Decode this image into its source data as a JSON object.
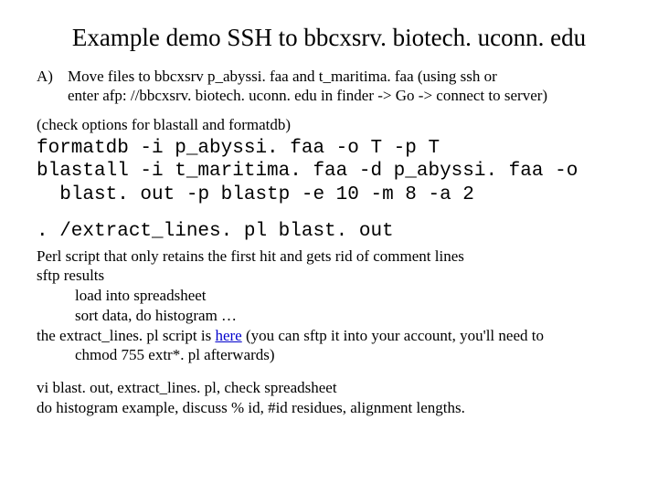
{
  "title": "Example demo SSH to bbcxsrv. biotech. uconn. edu",
  "stepA": {
    "marker": "A)",
    "line1": "Move files to bbcxsrv p_abyssi. faa and t_maritima. faa   (using ssh or",
    "line2": "enter afp: //bbcxsrv. biotech. uconn. edu in finder -> Go -> connect to server)"
  },
  "checkNote": "(check options for blastall and formatdb)",
  "code1": "formatdb -i p_abyssi. faa -o T -p T\nblastall -i t_maritima. faa -d p_abyssi. faa -o\n  blast. out -p blastp -e 10 -m 8 -a 2",
  "code2": ". /extract_lines. pl blast. out",
  "perlDesc": "Perl script that only retains the first hit and gets rid of comment lines",
  "sftpHeader": "sftp results",
  "sftp1": "load into spreadsheet",
  "sftp2": "sort data, do histogram …",
  "scriptNote": {
    "pre": "the extract_lines. pl script is ",
    "link": "here",
    "post": " (you can sftp it into your account, you'll need to"
  },
  "chmodLine": "chmod 755 extr*. pl afterwards)",
  "closing1": "vi blast. out, extract_lines. pl, check spreadsheet",
  "closing2": "do histogram example, discuss % id, #id residues, alignment lengths."
}
